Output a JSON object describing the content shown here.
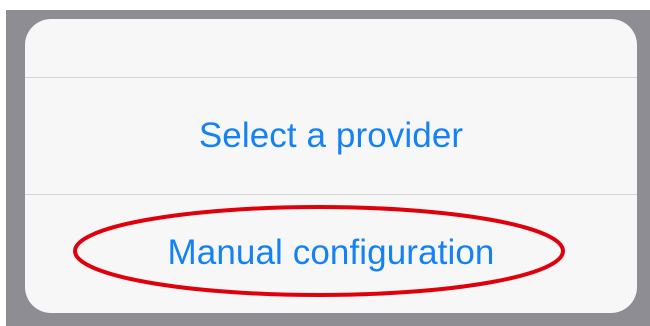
{
  "action_sheet": {
    "actions": [
      {
        "label": "Select a provider"
      },
      {
        "label": "Manual configuration"
      }
    ]
  },
  "colors": {
    "backdrop": "#8e8d93",
    "sheet_background": "#f7f7f7",
    "action_text": "#1582f4",
    "separator": "#d5d5d8",
    "highlight_annotation": "#e0000b"
  }
}
